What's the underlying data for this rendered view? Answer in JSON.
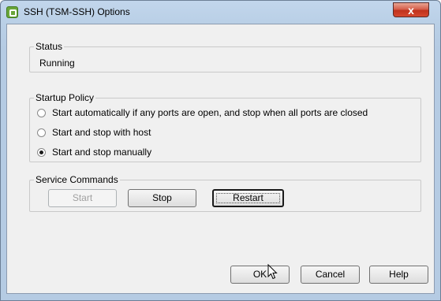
{
  "window": {
    "title": "SSH (TSM-SSH) Options",
    "close_label": "x"
  },
  "status": {
    "legend": "Status",
    "value": "Running"
  },
  "startup_policy": {
    "legend": "Startup Policy",
    "options": [
      {
        "label": "Start automatically if any ports are open, and stop when all ports are closed",
        "selected": false
      },
      {
        "label": "Start and stop with host",
        "selected": false
      },
      {
        "label": "Start and stop manually",
        "selected": true
      }
    ]
  },
  "service_commands": {
    "legend": "Service Commands",
    "start_label": "Start",
    "stop_label": "Stop",
    "restart_label": "Restart"
  },
  "footer": {
    "ok_label": "OK",
    "cancel_label": "Cancel",
    "help_label": "Help"
  }
}
